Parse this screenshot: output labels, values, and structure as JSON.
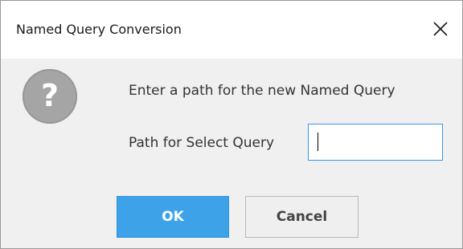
{
  "window": {
    "title": "Named Query Conversion",
    "close_icon": "close-icon"
  },
  "content": {
    "icon": "question-icon",
    "icon_glyph": "?",
    "message": "Enter a path for the new Named Query",
    "path_label": "Path for Select Query",
    "path_value": "",
    "path_placeholder": ""
  },
  "buttons": {
    "ok_label": "OK",
    "cancel_label": "Cancel"
  },
  "colors": {
    "ok_button": "#3da2e8",
    "input_focus_border": "#3399ee",
    "question_icon": "#a5a5a5"
  }
}
